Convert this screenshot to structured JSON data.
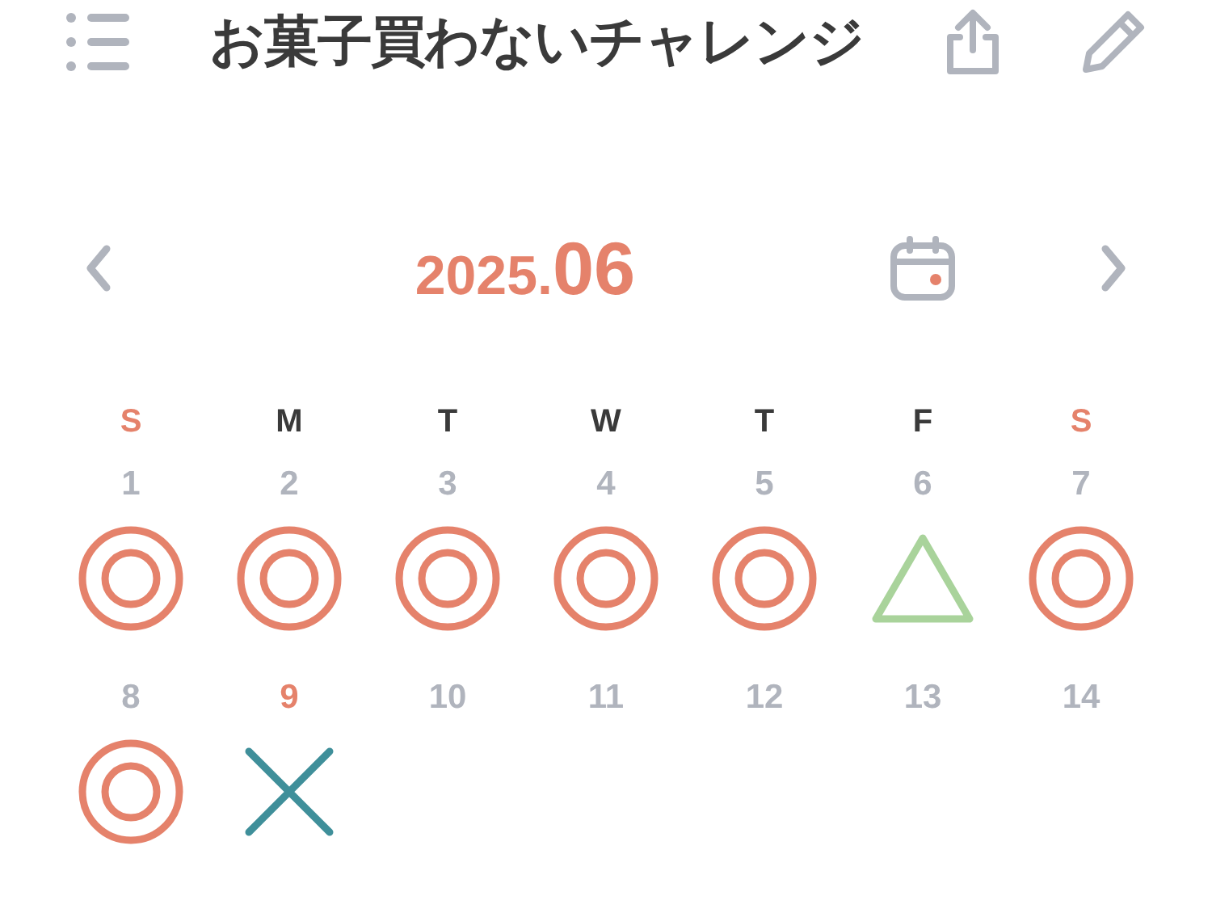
{
  "header": {
    "title": "お菓子買わないチャレンジ"
  },
  "month_nav": {
    "year": "2025.",
    "month": "06"
  },
  "weekdays": [
    {
      "label": "S",
      "weekend": true
    },
    {
      "label": "M",
      "weekend": false
    },
    {
      "label": "T",
      "weekend": false
    },
    {
      "label": "W",
      "weekend": false
    },
    {
      "label": "T",
      "weekend": false
    },
    {
      "label": "F",
      "weekend": false
    },
    {
      "label": "S",
      "weekend": true
    }
  ],
  "days": [
    {
      "day": "1",
      "today": false,
      "kind": "double_circle"
    },
    {
      "day": "2",
      "today": false,
      "kind": "double_circle"
    },
    {
      "day": "3",
      "today": false,
      "kind": "double_circle"
    },
    {
      "day": "4",
      "today": false,
      "kind": "double_circle"
    },
    {
      "day": "5",
      "today": false,
      "kind": "double_circle"
    },
    {
      "day": "6",
      "today": false,
      "kind": "triangle"
    },
    {
      "day": "7",
      "today": false,
      "kind": "double_circle"
    },
    {
      "day": "8",
      "today": false,
      "kind": "double_circle"
    },
    {
      "day": "9",
      "today": true,
      "kind": "cross"
    },
    {
      "day": "10",
      "today": false,
      "kind": "blank"
    },
    {
      "day": "11",
      "today": false,
      "kind": "blank"
    },
    {
      "day": "12",
      "today": false,
      "kind": "blank"
    },
    {
      "day": "13",
      "today": false,
      "kind": "blank"
    },
    {
      "day": "14",
      "today": false,
      "kind": "blank"
    }
  ]
}
